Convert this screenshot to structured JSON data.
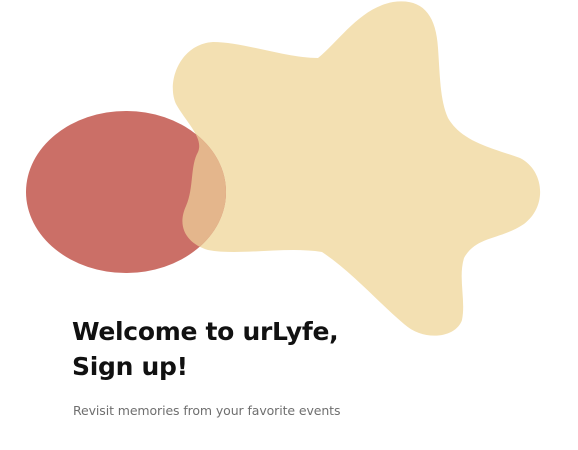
{
  "hero": {
    "title_line1": "Welcome to urLyfe,",
    "title_line2": "Sign up!",
    "subtitle": "Revisit memories from your favorite events"
  },
  "illustration": {
    "blob_color": "#f3e0b2",
    "ellipse_color": "#c8675f"
  }
}
